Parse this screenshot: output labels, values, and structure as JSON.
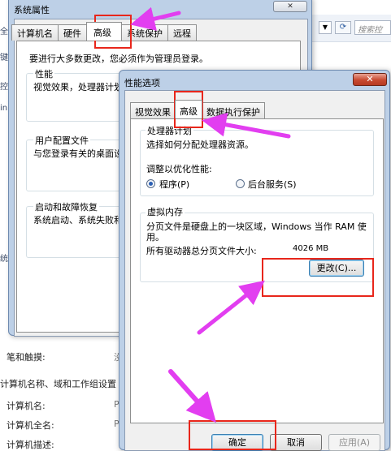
{
  "background": {
    "search_placeholder": "搜索控",
    "left_fragments": [
      "全",
      "键",
      "控",
      "in",
      "统"
    ],
    "rows": [
      {
        "label": "笔和触摸:",
        "value": "没"
      },
      {
        "label": "计算机名:",
        "value": "PC"
      },
      {
        "label": "计算机全名:",
        "value": "PC"
      },
      {
        "label": "计算机描述:",
        "value": ""
      }
    ],
    "section_title": "计算机名称、域和工作组设置"
  },
  "system_properties": {
    "title": "系统属性",
    "tabs": [
      "计算机名",
      "硬件",
      "高级",
      "系统保护",
      "远程"
    ],
    "active_tab": "高级",
    "admin_notice": "要进行大多数更改，您必须作为管理员登录。",
    "groups": [
      {
        "title": "性能",
        "desc": "视觉效果，处理器计划"
      },
      {
        "title": "用户配置文件",
        "desc": "与您登录有关的桌面设"
      },
      {
        "title": "启动和故障恢复",
        "desc": "系统启动、系统失败和"
      }
    ]
  },
  "performance_options": {
    "title": "性能选项",
    "close_label": "✕",
    "tabs": [
      "视觉效果",
      "高级",
      "数据执行保护"
    ],
    "active_tab": "高级",
    "processor": {
      "title": "处理器计划",
      "desc": "选择如何分配处理器资源。",
      "adjust_label": "调整以优化性能:",
      "options": [
        {
          "label": "程序(P)",
          "selected": true
        },
        {
          "label": "后台服务(S)",
          "selected": false
        }
      ]
    },
    "virtual_memory": {
      "title": "虚拟内存",
      "desc_line1": "分页文件是硬盘上的一块区域，Windows 当作 RAM 使",
      "desc_line2": "用。",
      "total_label": "所有驱动器总分页文件大小:",
      "total_value": "4026 MB",
      "change_button": "更改(C)..."
    },
    "buttons": {
      "ok": "确定",
      "cancel": "取消",
      "apply": "应用(A)"
    }
  },
  "colors": {
    "annotation_box": "#e8261b",
    "annotation_arrow": "#e23ef0"
  }
}
